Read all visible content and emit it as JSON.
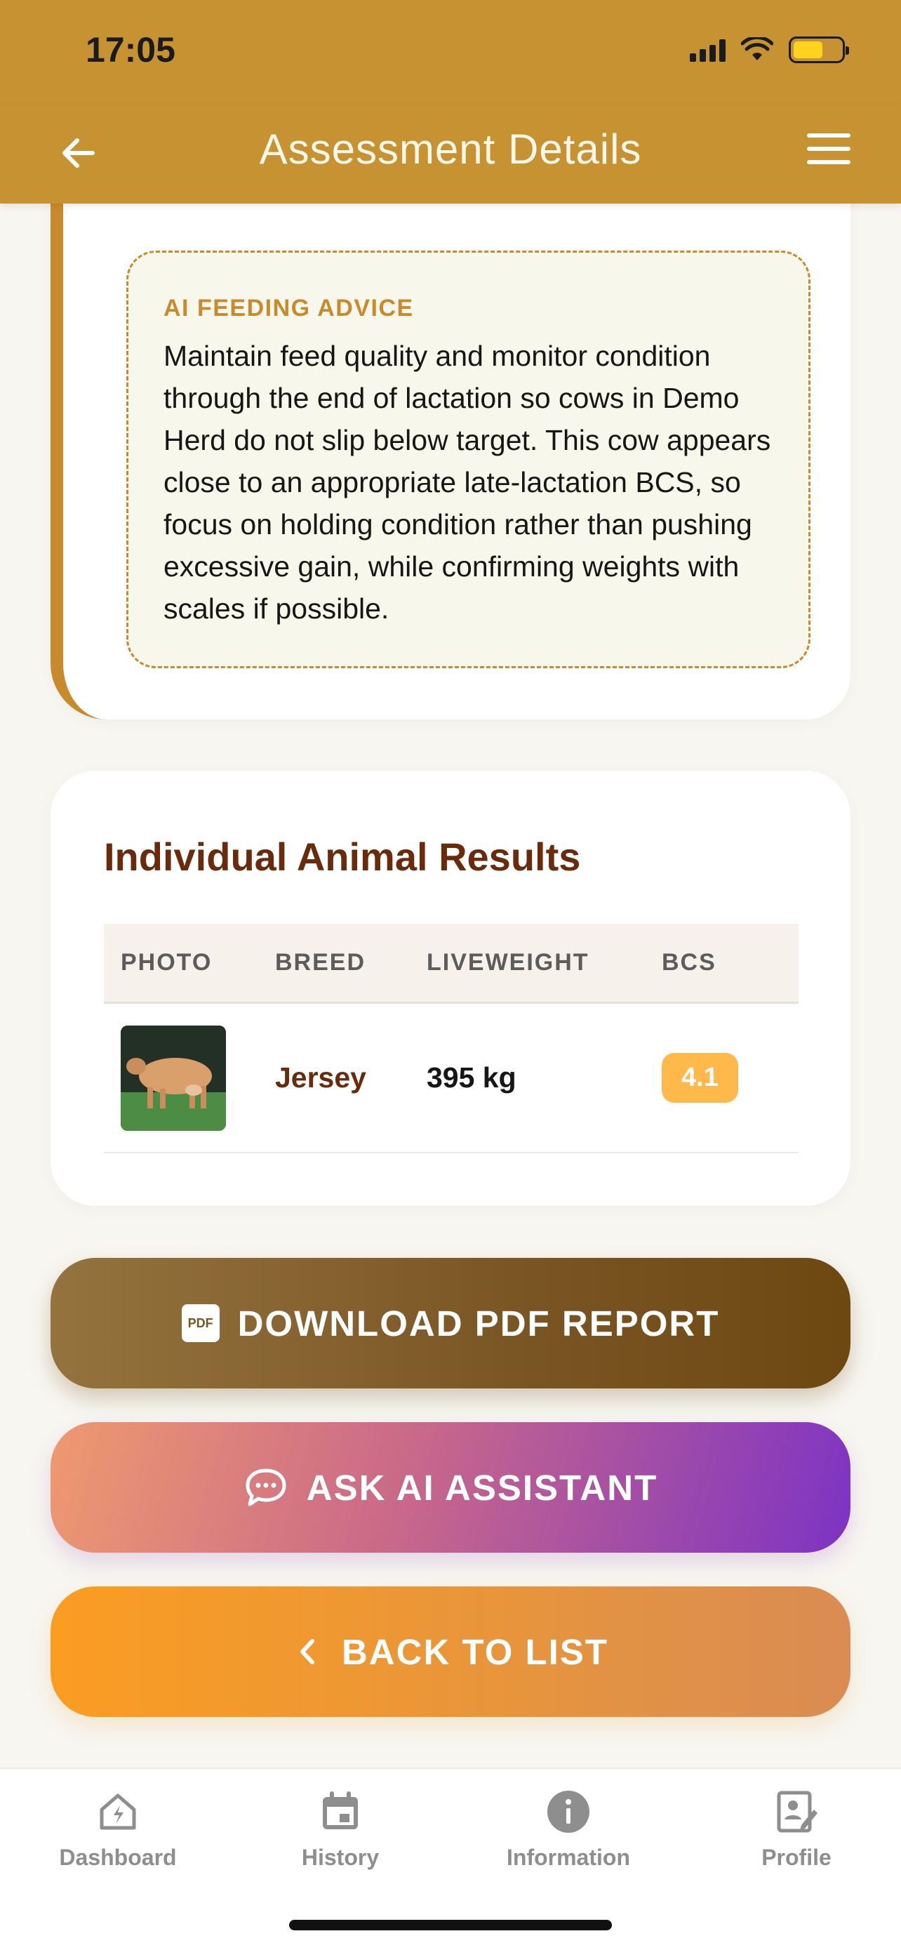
{
  "status_bar": {
    "time": "17:05"
  },
  "header": {
    "title": "Assessment Details"
  },
  "ai_advice": {
    "title": "AI FEEDING ADVICE",
    "text": "Maintain feed quality and monitor condition through the end of lactation so cows in Demo Herd do not slip below target. This cow appears close to an appropriate late-lactation BCS, so focus on holding condition rather than pushing excessive gain, while confirming weights with scales if possible."
  },
  "results": {
    "title": "Individual Animal Results",
    "columns": [
      "PHOTO",
      "BREED",
      "LIVEWEIGHT",
      "BCS"
    ],
    "rows": [
      {
        "breed": "Jersey",
        "liveweight": "395 kg",
        "bcs": "4.1"
      }
    ]
  },
  "buttons": {
    "pdf": "DOWNLOAD PDF REPORT",
    "pdf_icon_text": "PDF",
    "ai": "ASK AI ASSISTANT",
    "back": "BACK TO LIST"
  },
  "tabbar": {
    "items": [
      {
        "label": "Dashboard",
        "icon": "home-icon"
      },
      {
        "label": "History",
        "icon": "calendar-icon"
      },
      {
        "label": "Information",
        "icon": "info-icon"
      },
      {
        "label": "Profile",
        "icon": "profile-edit-icon"
      }
    ]
  },
  "colors": {
    "header": "#c69232",
    "accent_brown": "#6a2a0c",
    "advice_border": "#c98a2e",
    "bcs_badge": "#ffb84a"
  }
}
